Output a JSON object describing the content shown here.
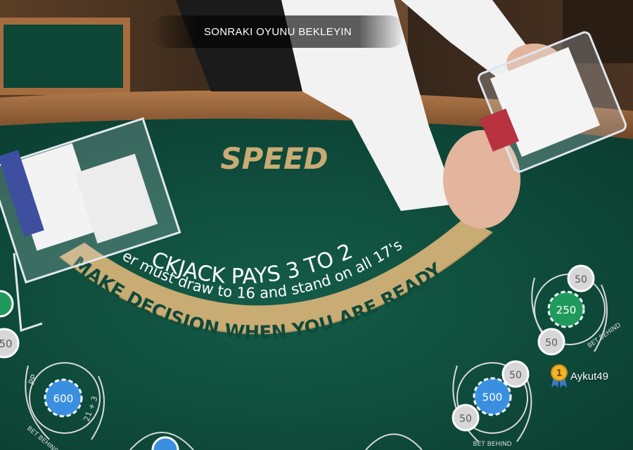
{
  "status": {
    "message": "SONRAKI OYUNU BEKLEYIN"
  },
  "table": {
    "brand": "SPEED",
    "payout_text": "CKJACK PAYS 3 TO 2",
    "dealer_rule_text": "er must draw to 16 and stand on all 17's",
    "decision_text": "MAKE DECISION WHEN YOU ARE READY"
  },
  "seats": [
    {
      "main_chip": "600",
      "side_left": "PP",
      "side_right": "21 + 3",
      "bet_behind": "BET BEHIND"
    },
    {
      "main_chip": "500",
      "side_chip": "50",
      "bet_behind": "BET BEHIND"
    },
    {
      "main_chip": "250",
      "side_chip_top": "50",
      "side_chip_bottom": "50",
      "bet_behind": "BET BEHIND"
    }
  ],
  "left_seat_chip": "50",
  "player": {
    "rank": "1",
    "name": "Aykut49"
  },
  "colors": {
    "felt": "#0f4a3a",
    "gold": "#c9ab74",
    "rail": "#8a5a32"
  }
}
